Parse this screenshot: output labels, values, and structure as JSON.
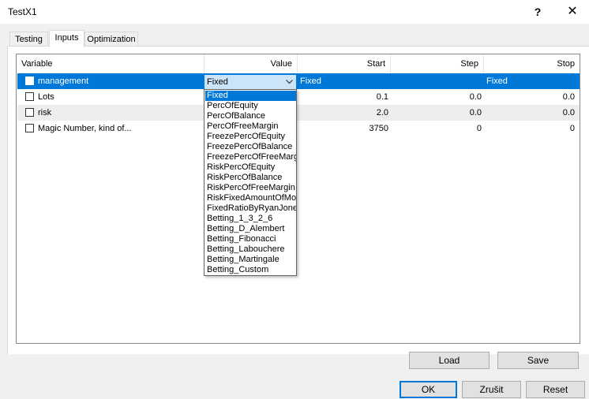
{
  "window": {
    "title": "TestX1",
    "help_label": "?",
    "close_label": "✕"
  },
  "tabs": [
    {
      "label": "Testing",
      "active": false
    },
    {
      "label": "Inputs",
      "active": true
    },
    {
      "label": "Optimization",
      "active": false
    }
  ],
  "grid": {
    "columns": [
      "Variable",
      "Value",
      "Start",
      "Step",
      "Stop"
    ],
    "rows": [
      {
        "variable": "management",
        "value": "Fixed",
        "start": "Fixed",
        "step": "",
        "stop": "Fixed",
        "checked": false,
        "selected": true
      },
      {
        "variable": "Lots",
        "value": "",
        "start": "0.1",
        "step": "0.0",
        "stop": "0.0",
        "checked": false,
        "selected": false
      },
      {
        "variable": "risk",
        "value": "",
        "start": "2.0",
        "step": "0.0",
        "stop": "0.0",
        "checked": false,
        "selected": false
      },
      {
        "variable": "Magic Number, kind of...",
        "value": "",
        "start": "3750",
        "step": "0",
        "stop": "0",
        "checked": false,
        "selected": false
      }
    ]
  },
  "combo": {
    "value": "Fixed",
    "arrow_icon": "chevron-down-icon",
    "options": [
      "Fixed",
      "PercOfEquity",
      "PercOfBalance",
      "PercOfFreeMargin",
      "FreezePercOfEquity",
      "FreezePercOfBalance",
      "FreezePercOfFreeMargin",
      "RiskPercOfEquity",
      "RiskPercOfBalance",
      "RiskPercOfFreeMargin",
      "RiskFixedAmountOfMoney",
      "FixedRatioByRyanJones",
      "Betting_1_3_2_6",
      "Betting_D_Alembert",
      "Betting_Fibonacci",
      "Betting_Labouchere",
      "Betting_Martingale",
      "Betting_Custom"
    ]
  },
  "buttons": {
    "load": "Load",
    "save": "Save",
    "ok": "OK",
    "cancel": "Zrušit",
    "reset": "Reset"
  },
  "colors": {
    "selection": "#0078d7",
    "combo_bg": "#cce4f7",
    "dialog_bg": "#f0f0f0"
  }
}
